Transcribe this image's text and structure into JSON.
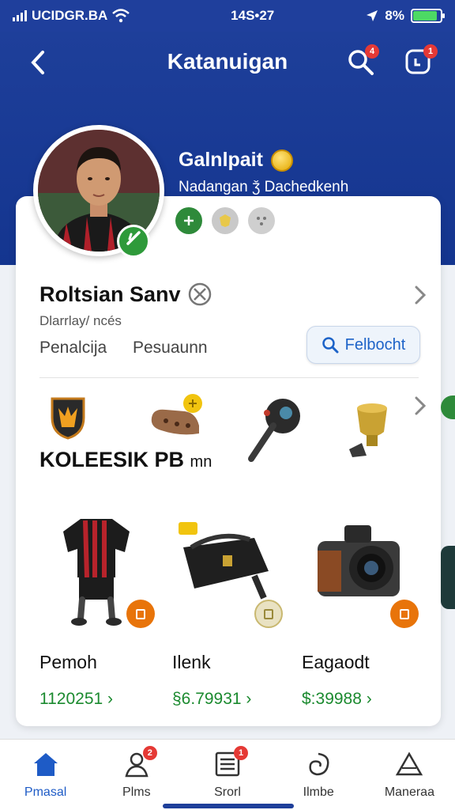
{
  "status_bar": {
    "carrier": "UCIDGR.BA",
    "time": "14S•27",
    "battery_text": "8%"
  },
  "header": {
    "title": "Katanuigan",
    "search_badge": "4",
    "notif_badge": "1"
  },
  "profile": {
    "name": "Galnlpait",
    "subtitle": "Nadangan ǯ Dachedkenh",
    "rank_name": "Roltsian Sanv",
    "rank_sub": "Dlarrlay/ ncés",
    "stat_a": "Penalcija",
    "stat_b": "Pesuaunn",
    "search_label": "Felbocht"
  },
  "collection": {
    "title": "KOLEESIK PB",
    "title_suffix": "mn"
  },
  "items": [
    {
      "name": "Pemoh",
      "price": "1120251 ›"
    },
    {
      "name": "Ilenk",
      "price": "§6.79931 ›"
    },
    {
      "name": "Eagaodt",
      "price": "$:39988 ›"
    }
  ],
  "nav": [
    {
      "label": "Pmasal",
      "icon": "home-icon"
    },
    {
      "label": "Plms",
      "icon": "person-icon",
      "badge": "2"
    },
    {
      "label": "Srorl",
      "icon": "list-icon",
      "badge": "1"
    },
    {
      "label": "Ilmbe",
      "icon": "spiral-icon"
    },
    {
      "label": "Maneraa",
      "icon": "triangle-icon"
    }
  ],
  "colors": {
    "brand": "#1e3f9a",
    "accent_green": "#1b8a2f",
    "link_blue": "#1d63c8",
    "badge_red": "#e53935"
  }
}
